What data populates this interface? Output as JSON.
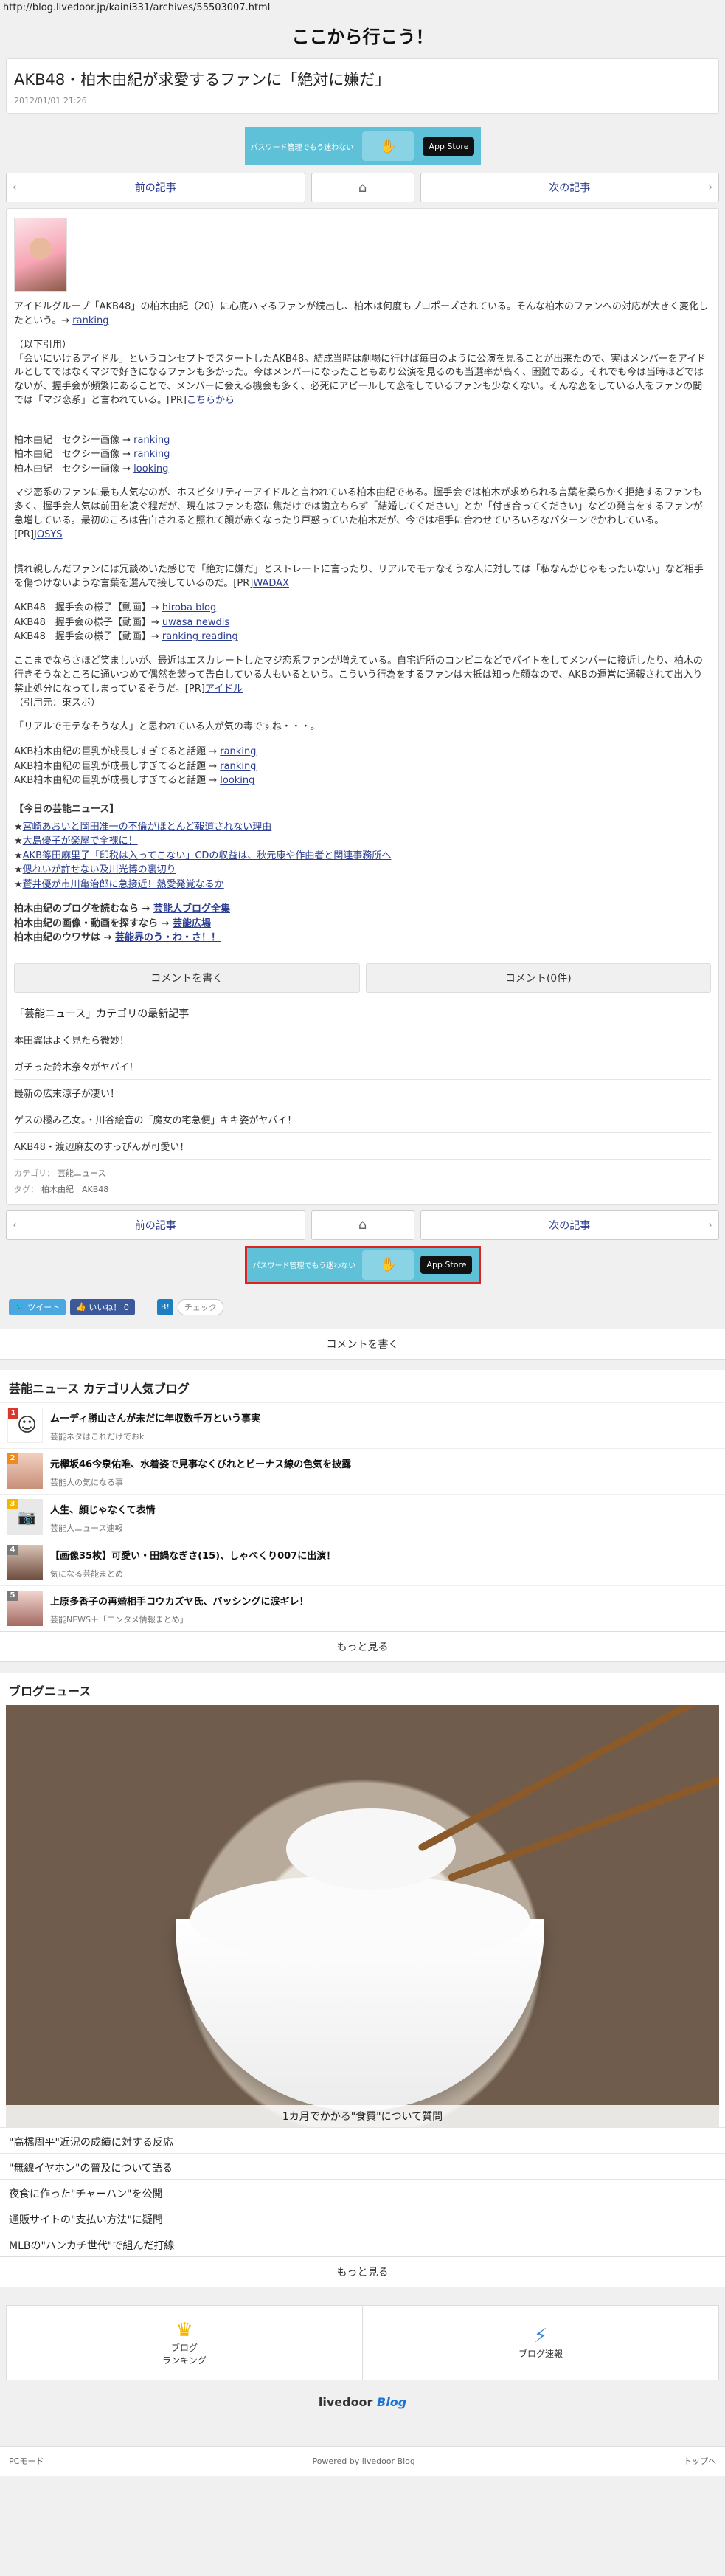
{
  "url": "http://blog.livedoor.jp/kaini331/archives/55503007.html",
  "site_title": "ここから行こう！",
  "article": {
    "title": "AKB48・柏木由紀が求愛するファンに「絶対に嫌だ」",
    "date": "2012/01/01 21:26"
  },
  "ad": {
    "text": "パスワード管理でもう迷わない",
    "store": " App Store"
  },
  "pager": {
    "prev": "前の記事",
    "next": "次の記事"
  },
  "body": {
    "p1": "アイドルグループ「AKB48」の柏木由紀（20）に心底ハマるファンが続出し、柏木は何度もプロポーズされている。そんな柏木のファンへの対応が大きく変化したという。→",
    "p1_link": "ranking",
    "quote_head": "（以下引用）",
    "p2": "「会いにいけるアイドル」というコンセプトでスタートしたAKB48。結成当時は劇場に行けば毎日のように公演を見ることが出来たので、実はメンバーをアイドルとしてではなくマジで好きになるファンも多かった。今はメンバーになったこともあり公演を見るのも当選率が高く、困難である。それでも今は当時ほどではないが、握手会が頻繁にあることで、メンバーに会える機会も多く、必死にアピールして恋をしているファンも少なくない。そんな恋をしている人をファンの間では「マジ恋系」と言われている。[PR]",
    "p2_link": "こちらから",
    "sexy_lines": [
      {
        "text": "柏木由紀　セクシー画像 →",
        "link": "ranking"
      },
      {
        "text": "柏木由紀　セクシー画像 →",
        "link": "ranking"
      },
      {
        "text": "柏木由紀　セクシー画像 →",
        "link": "looking"
      }
    ],
    "p3": "マジ恋系のファンに最も人気なのが、ホスピタリティーアイドルと言われている柏木由紀である。握手会では柏木が求められる言葉を柔らかく拒絶するファンも多く、握手会人気は前田を凌ぐ程だが、現在はファンも恋に焦だけでは歯立ちらず「結婚してください」とか「付き合ってください」などの発言をするファンが急増している。最初のころは告白されると照れて顔が赤くなったり戸惑っていた柏木だが、今では相手に合わせていろいろなパターンでかわしている。[PR]",
    "p3_link": "JOSYS",
    "p4": "慣れ親しんだファンには冗談めいた感じで「絶対に嫌だ」とストレートに言ったり、リアルでモテなそうな人に対しては「私なんかじゃもったいない」など相手を傷つけないような言葉を選んで接しているのだ。[PR]",
    "p4_link": "WADAX",
    "handshake_lines": [
      {
        "text": "AKB48　握手会の様子【動画】→",
        "link": "hiroba blog"
      },
      {
        "text": "AKB48　握手会の様子【動画】→",
        "link": "uwasa newdis"
      },
      {
        "text": "AKB48　握手会の様子【動画】→",
        "link": "ranking reading"
      }
    ],
    "p5": "ここまでならさほど笑ましいが、最近はエスカレートしたマジ恋系ファンが増えている。自宅近所のコンビニなどでバイトをしてメンバーに接近したり、柏木の行きそうなところに通いつめて偶然を装って告白している人もいるという。こういう行為をするファンは大抵は知った顔なので、AKBの運営に通報されて出入り禁止処分になってしまっているそうだ。[PR]",
    "p5_link": "アイドル",
    "p5_src": "（引用元：東スポ）",
    "p6": "「リアルでモテなそうな人」と思われている人が気の毒ですね・・・。",
    "breast_lines": [
      {
        "text": "AKB柏木由紀の巨乳が成長しすぎてると話題 →",
        "link": "ranking"
      },
      {
        "text": "AKB柏木由紀の巨乳が成長しすぎてると話題 →",
        "link": "ranking"
      },
      {
        "text": "AKB柏木由紀の巨乳が成長しすぎてると話題 →",
        "link": "looking"
      }
    ],
    "today_head": "【今日の芸能ニュース】",
    "today_items": [
      "宮崎あおいと岡田准一の不倫がほとんど報道されない理由",
      "大島優子が楽屋で全裸に！",
      "AKB篠田麻里子「印税は入ってこない」CDの収益は、秋元康や作曲者と関連事務所へ",
      "偲れいが許せない及川光博の裏切り",
      "蒼井優が市川亀治郎に急接近！熱愛発覚なるか"
    ],
    "blog_lines": [
      {
        "text": "柏木由紀のブログを読むなら →",
        "link": "芸能人ブログ全集"
      },
      {
        "text": "柏木由紀の画像・動画を探すなら →",
        "link": "芸能広場"
      },
      {
        "text": "柏木由紀のウワサは →",
        "link": "芸能界のう・わ・さ！！"
      }
    ]
  },
  "comment_buttons": {
    "write": "コメントを書く",
    "count": "コメント(0件)"
  },
  "category": {
    "head": "「芸能ニュース」カテゴリの最新記事",
    "items": [
      "本田翼はよく見たら微妙！",
      "ガチった鈴木奈々がヤバイ！",
      "最新の広末涼子が凄い！",
      "ゲスの極み乙女。・川谷絵音の「魔女の宅急便」キキ姿がヤバイ！",
      "AKB48・渡辺麻友のすっぴんが可愛い！"
    ]
  },
  "meta": {
    "category_label": "カテゴリ：",
    "category_value": "芸能ニュース",
    "tag_label": "タグ：",
    "tags": "柏木由紀　AKB48"
  },
  "social": {
    "tweet": "ツイート",
    "like": "いいね！ 0",
    "hatena": "B!",
    "mixi": "チェック"
  },
  "write_comment": "コメントを書く",
  "popular": {
    "head": "芸能ニュース カテゴリ人気ブログ",
    "items": [
      {
        "rank": "1",
        "title": "ムーディ勝山さんが未だに年収数千万という事実",
        "sub": "芸能ネタはこれだけでおk"
      },
      {
        "rank": "2",
        "title": "元欅坂46今泉佑唯、水着姿で見事なくびれとビーナス線の色気を披露",
        "sub": "芸能人の気になる事"
      },
      {
        "rank": "3",
        "title": "人生、顔じゃなくて表情",
        "sub": "芸能人ニュース速報"
      },
      {
        "rank": "4",
        "title": "【画像35枚】可愛い・田鍋なぎさ(15)、しゃべくり007に出演！",
        "sub": "気になる芸能まとめ"
      },
      {
        "rank": "5",
        "title": "上原多香子の再婚相手コウカズヤ氏、バッシングに涙ギレ！",
        "sub": "芸能NEWS＋「エンタメ情報まとめ」"
      }
    ],
    "more": "もっと見る"
  },
  "blog_news": {
    "head": "ブログニュース",
    "caption": "1カ月でかかる\"食費\"について質問",
    "items": [
      "\"高橋周平\"近況の成績に対する反応",
      "\"無線イヤホン\"の普及について語る",
      "夜食に作った\"チャーハン\"を公開",
      "通販サイトの\"支払い方法\"に疑問",
      "MLBの\"ハンカチ世代\"で組んだ打線"
    ],
    "more": "もっと見る"
  },
  "footer_nav": {
    "ranking": "ブログ\nランキング",
    "speed": "ブログ速報"
  },
  "logo": {
    "livedoor": "livedoor",
    "blog": "Blog"
  },
  "bottom": {
    "pc": "PCモード",
    "powered": "Powered by livedoor Blog",
    "top": "トップへ"
  },
  "colors": {
    "link": "#2a3c8f",
    "ad_bg": "#5ec1d8",
    "twitter": "#4aa7e0",
    "facebook": "#3b5998",
    "rank1": "#d9362c",
    "rank2": "#f08a1c",
    "rank3": "#f2b500",
    "rank4": "#7a7a7a",
    "rank5": "#7a7a7a"
  }
}
